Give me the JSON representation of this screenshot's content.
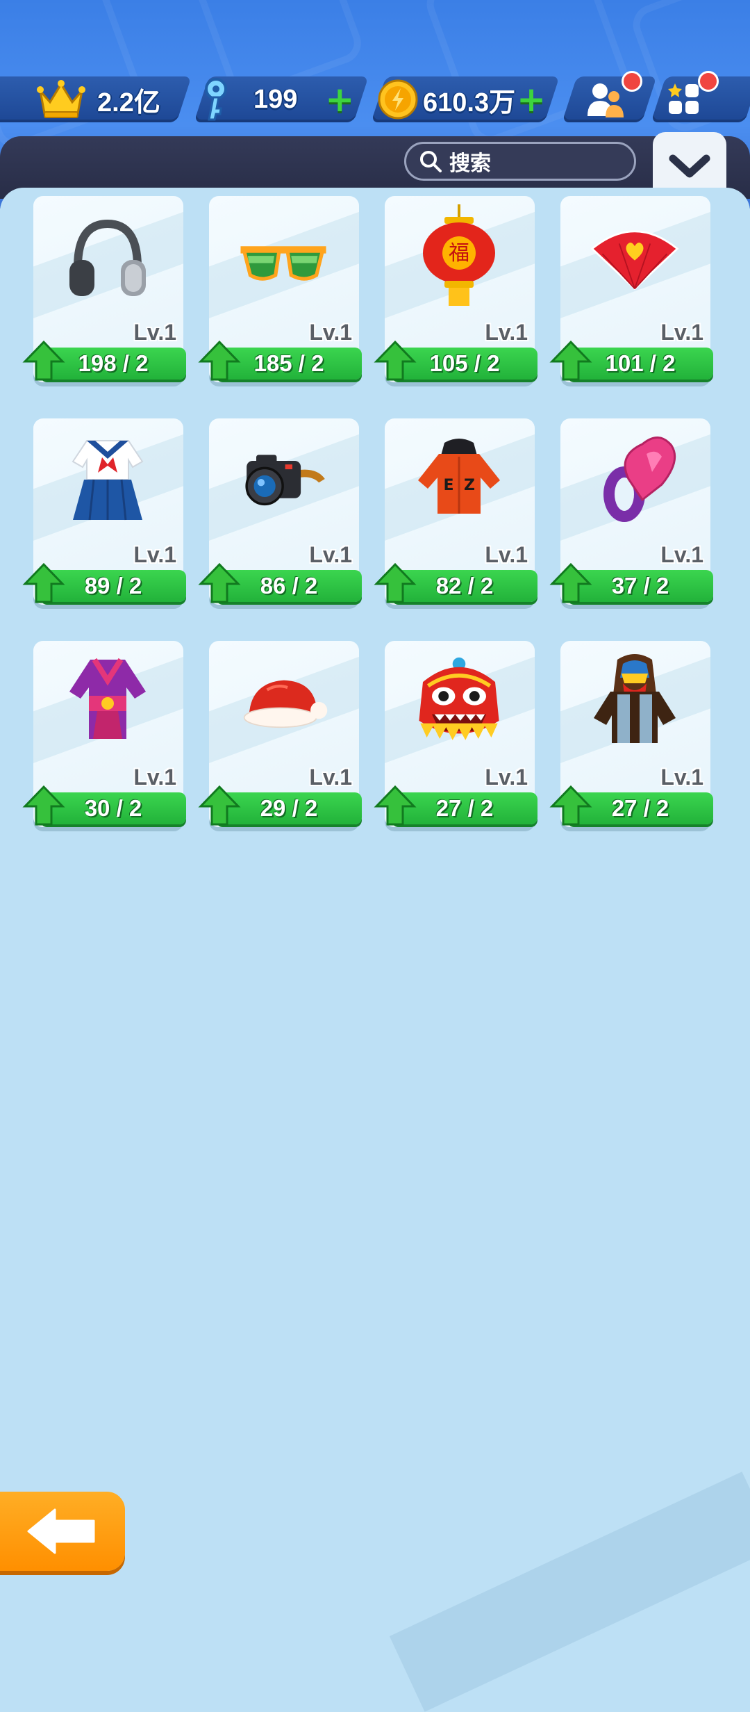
{
  "resources": {
    "crown_value": "2.2亿",
    "key_value": "199",
    "coin_value": "610.3万"
  },
  "search": {
    "label": "搜索"
  },
  "items": [
    {
      "icon": "headphones-icon",
      "level": "Lv.1",
      "progress": "198 / 2"
    },
    {
      "icon": "sunglasses-icon",
      "level": "Lv.1",
      "progress": "185 / 2"
    },
    {
      "icon": "lantern-icon",
      "level": "Lv.1",
      "progress": "105 / 2"
    },
    {
      "icon": "heart-fan-icon",
      "level": "Lv.1",
      "progress": "101 / 2"
    },
    {
      "icon": "sailor-uniform-icon",
      "level": "Lv.1",
      "progress": "89 / 2"
    },
    {
      "icon": "camera-icon",
      "level": "Lv.1",
      "progress": "86 / 2"
    },
    {
      "icon": "red-hoodie-icon",
      "level": "Lv.1",
      "progress": "82 / 2"
    },
    {
      "icon": "heart-ring-icon",
      "level": "Lv.1",
      "progress": "37 / 2"
    },
    {
      "icon": "kimono-icon",
      "level": "Lv.1",
      "progress": "30 / 2"
    },
    {
      "icon": "santa-hat-icon",
      "level": "Lv.1",
      "progress": "29 / 2"
    },
    {
      "icon": "lion-dance-head-icon",
      "level": "Lv.1",
      "progress": "27 / 2"
    },
    {
      "icon": "hooded-vest-icon",
      "level": "Lv.1",
      "progress": "27 / 2"
    }
  ],
  "colors": {
    "accent_green": "#2ac443",
    "header_blue": "#3b7fe6",
    "back_orange": "#ff9d10"
  }
}
